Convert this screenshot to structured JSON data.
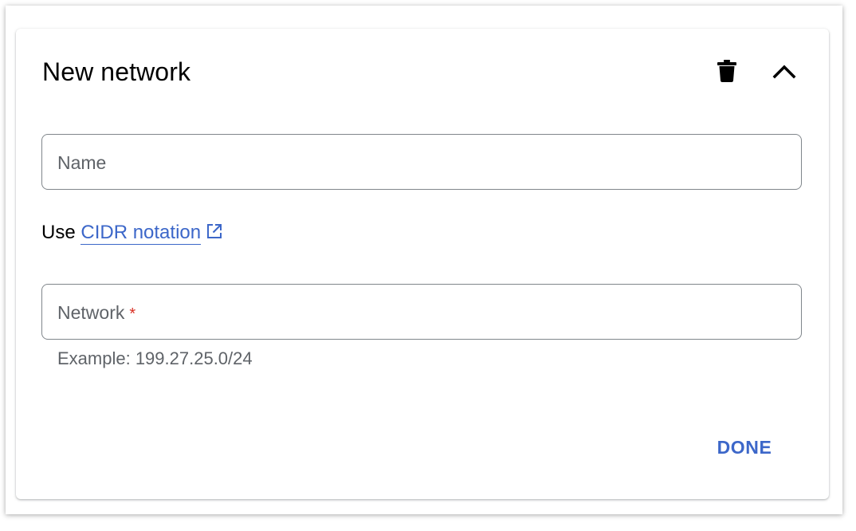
{
  "dialog": {
    "title": "New network",
    "icons": {
      "delete": "trash-icon",
      "collapse": "chevron-up-icon",
      "external": "open-in-new-icon"
    }
  },
  "fields": {
    "name": {
      "label": "Name",
      "value": ""
    },
    "network": {
      "label": "Network",
      "required_marker": "*",
      "value": "",
      "helper": "Example: 199.27.25.0/24"
    }
  },
  "hint": {
    "prefix": "Use",
    "link_text": "CIDR notation"
  },
  "actions": {
    "done_label": "DONE"
  },
  "colors": {
    "accent": "#3c67c9",
    "required": "#d93025",
    "border": "#80868b",
    "muted_text": "#5f6368"
  }
}
